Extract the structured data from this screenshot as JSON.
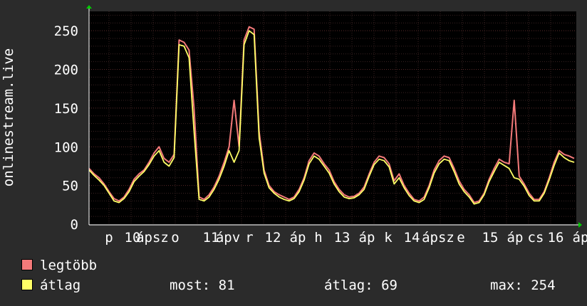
{
  "chart_data": {
    "type": "line",
    "ylabel": "onlinestream.live",
    "ylim": [
      0,
      275
    ],
    "yticks": [
      0,
      50,
      100,
      150,
      200,
      250
    ],
    "grid": true,
    "x_tick_labels": [
      "p",
      "10",
      "ápsz",
      "o",
      "11",
      "ápv",
      "r",
      "12",
      "áp",
      "h",
      "13",
      "áp",
      "k",
      "14",
      "ápsz",
      "e",
      "15",
      "áp",
      "cs",
      "16",
      "áp"
    ],
    "series": [
      {
        "name": "legtöbb",
        "color": "#f47a7a",
        "values": [
          72,
          65,
          60,
          52,
          42,
          33,
          30,
          35,
          45,
          58,
          65,
          70,
          80,
          92,
          100,
          85,
          80,
          90,
          238,
          235,
          225,
          150,
          35,
          32,
          38,
          48,
          62,
          80,
          100,
          160,
          100,
          238,
          255,
          252,
          120,
          70,
          50,
          42,
          38,
          35,
          32,
          35,
          45,
          60,
          82,
          92,
          88,
          78,
          70,
          55,
          45,
          38,
          35,
          36,
          40,
          48,
          65,
          80,
          88,
          86,
          78,
          56,
          65,
          50,
          40,
          32,
          30,
          35,
          50,
          70,
          82,
          88,
          86,
          72,
          56,
          45,
          38,
          28,
          30,
          40,
          58,
          72,
          84,
          80,
          78,
          160,
          62,
          52,
          40,
          32,
          32,
          42,
          60,
          80,
          95,
          90,
          88,
          85
        ]
      },
      {
        "name": "átlag",
        "color": "#ffff66",
        "values": [
          70,
          63,
          57,
          50,
          40,
          30,
          28,
          33,
          42,
          55,
          62,
          68,
          77,
          88,
          95,
          80,
          75,
          86,
          232,
          230,
          215,
          120,
          32,
          30,
          35,
          45,
          58,
          75,
          95,
          80,
          95,
          232,
          250,
          245,
          112,
          66,
          47,
          40,
          35,
          32,
          30,
          33,
          42,
          57,
          78,
          88,
          84,
          75,
          66,
          52,
          42,
          35,
          33,
          34,
          38,
          45,
          62,
          77,
          84,
          82,
          74,
          52,
          60,
          47,
          37,
          30,
          28,
          32,
          47,
          66,
          78,
          84,
          82,
          68,
          52,
          42,
          35,
          26,
          28,
          38,
          55,
          68,
          80,
          76,
          72,
          60,
          58,
          49,
          37,
          30,
          30,
          40,
          57,
          76,
          92,
          86,
          82,
          80
        ]
      }
    ]
  },
  "legend": {
    "items": [
      {
        "label": "legtöbb",
        "color": "#f47a7a"
      },
      {
        "label": "átlag",
        "color": "#ffff66"
      }
    ],
    "stats": {
      "most": "most: 81",
      "atlag": "átlag: 69",
      "max": "max: 254"
    }
  }
}
